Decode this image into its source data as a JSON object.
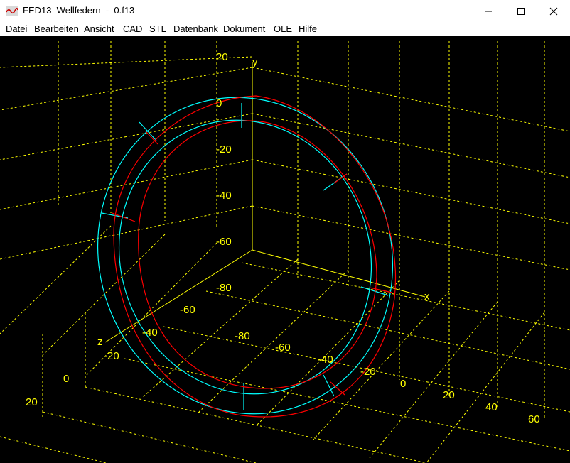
{
  "window": {
    "title": "FED13  Wellfedern  -  0.f13"
  },
  "menu": {
    "items": [
      {
        "id": "datei",
        "label": "Datei"
      },
      {
        "id": "bearbeiten",
        "label": "Bearbeiten"
      },
      {
        "id": "ansicht",
        "label": "Ansicht"
      },
      {
        "id": "cad",
        "label": "CAD"
      },
      {
        "id": "stl",
        "label": "STL"
      },
      {
        "id": "datenbank",
        "label": "Datenbank"
      },
      {
        "id": "dokument",
        "label": "Dokument"
      },
      {
        "id": "ole",
        "label": "OLE"
      },
      {
        "id": "hilfe",
        "label": "Hilfe"
      }
    ]
  },
  "plot": {
    "axes": {
      "x": "x",
      "y": "y",
      "z": "z"
    },
    "y_ticks": [
      "20",
      "0",
      "-20",
      "-40",
      "-60",
      "-80"
    ],
    "z_ticks": [
      "-60",
      "-40",
      "-20",
      "0",
      "20"
    ],
    "x_ticks": [
      "-80",
      "-60",
      "-40",
      "-20",
      "0",
      "20",
      "40",
      "60"
    ],
    "colors": {
      "background": "#000000",
      "grid": "#ffff00",
      "outline": "#00ffff",
      "curve": "#ff0000"
    }
  }
}
